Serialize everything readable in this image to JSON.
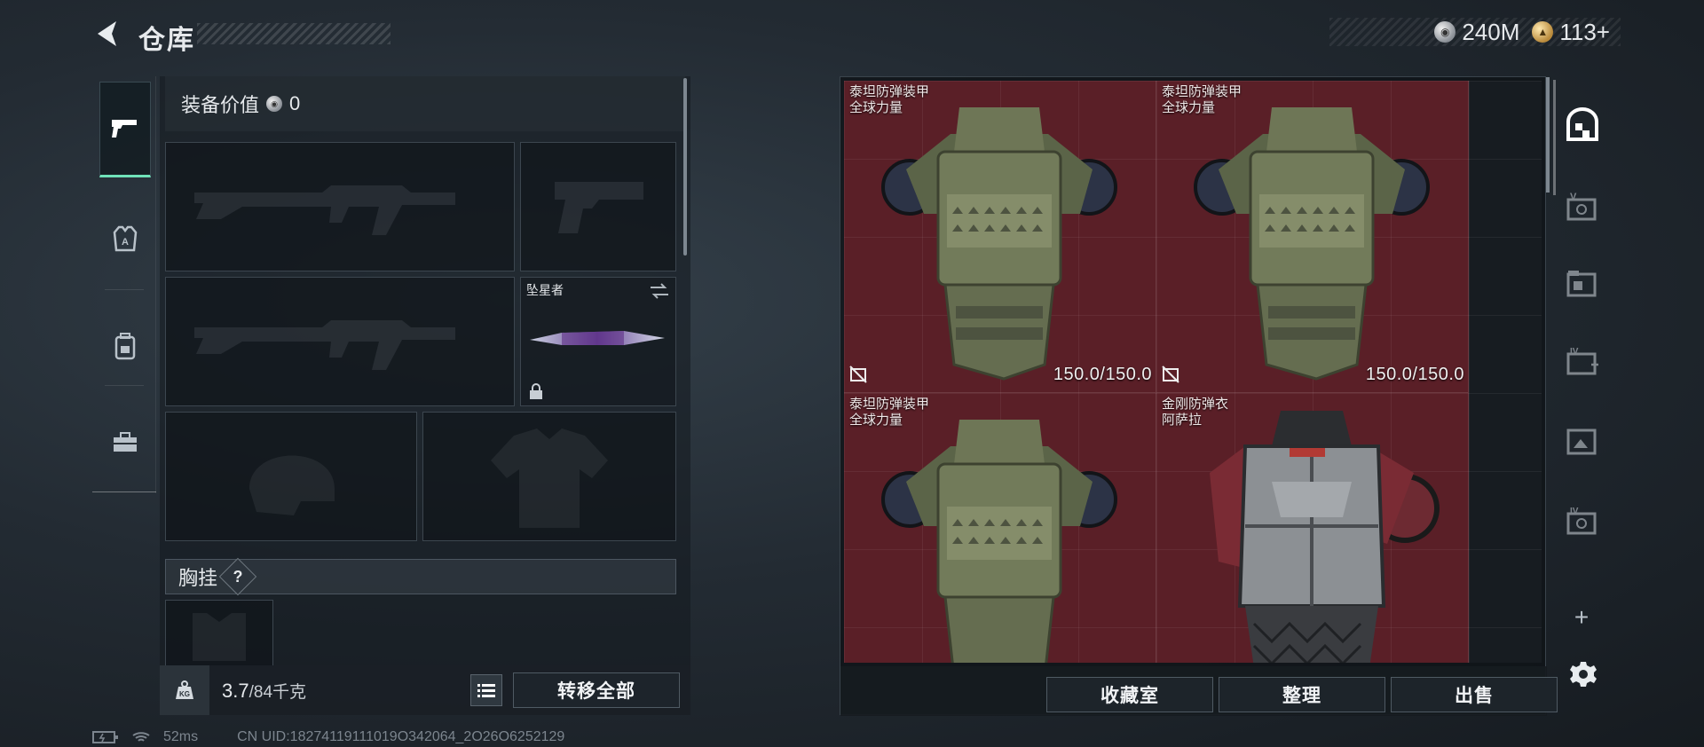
{
  "header": {
    "title": "仓库"
  },
  "currency": {
    "silver_amount": "240M",
    "gold_amount": "113+"
  },
  "left_tabs": [
    "pistol-icon",
    "armor-icon",
    "backpack-icon",
    "toolbox-icon"
  ],
  "loadout": {
    "equip_value_label": "装备价值",
    "equip_value": "0",
    "melee_name": "坠星者",
    "chest_rig_label": "胸挂",
    "chest_rig_help": "?",
    "weight_current": "3.7",
    "weight_max": "/84千克",
    "transfer_all_label": "转移全部"
  },
  "storage": {
    "items": [
      {
        "name": "泰坦防弹装甲",
        "sub": "全球力量",
        "durability": "150.0/150.0"
      },
      {
        "name": "泰坦防弹装甲",
        "sub": "全球力量",
        "durability": "150.0/150.0"
      },
      {
        "name": "泰坦防弹装甲",
        "sub": "全球力量",
        "durability": ""
      },
      {
        "name": "金刚防弹衣",
        "sub": "阿萨拉",
        "durability": ""
      }
    ],
    "collection_label": "收藏室",
    "sort_label": "整理",
    "sell_label": "出售"
  },
  "right_tabs": [
    "home-storage-icon",
    "case-v-icon",
    "folder-case-icon",
    "case-iv-plus-icon",
    "case-photo-icon",
    "case-iv-icon"
  ],
  "status": {
    "ping": "52ms",
    "uid": "CN UID:18274119111019O342064_2O26O6252129"
  },
  "colors": {
    "accent": "#6fe3b9",
    "storage_red": "#5a1f27"
  }
}
